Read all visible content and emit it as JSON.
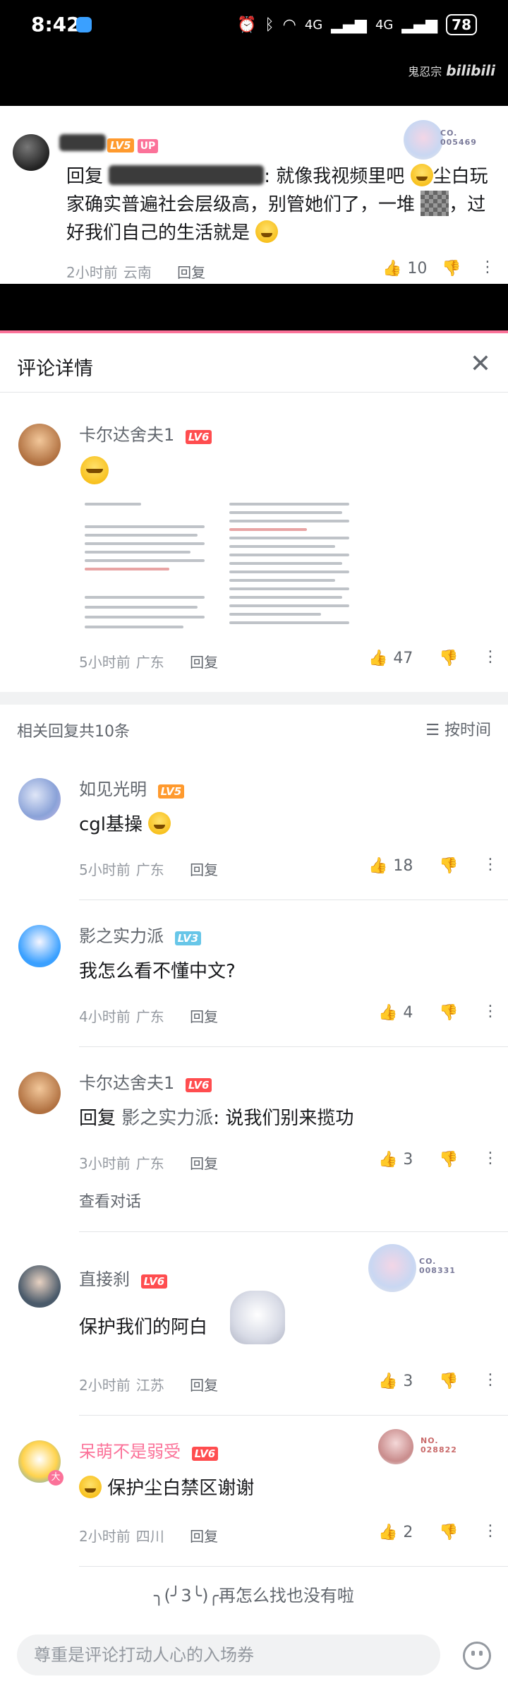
{
  "status_bar": {
    "time": "8:42",
    "battery": "78",
    "signal_a": "4G",
    "signal_b": "4G"
  },
  "video": {
    "watermark_name": "鬼忍宗",
    "watermark_brand": "bilibili"
  },
  "top_comment": {
    "level": "LV5",
    "up_tag": "UP",
    "text_prefix": "回复",
    "text_a": ": 就像我视频里吧",
    "text_b": "尘白玩家确实普遍社会层级高，别管她们了，一堆",
    "text_c": "，过好我们自己的生活就是",
    "time": "2小时前",
    "location": "云南",
    "reply": "回复",
    "likes": "10",
    "badge_no": "CO.\n005469"
  },
  "panel": {
    "title": "评论详情",
    "main": {
      "username": "卡尔达舍夫1",
      "level": "LV6",
      "time": "5小时前",
      "location": "广东",
      "reply": "回复",
      "likes": "47"
    },
    "replies_header": "相关回复共10条",
    "sort": "按时间",
    "replies": [
      {
        "username": "如见光明",
        "level": "LV5",
        "text": "cgl基操",
        "time": "5小时前",
        "location": "广东",
        "reply": "回复",
        "likes": "18"
      },
      {
        "username": "影之实力派",
        "level": "LV3",
        "text": "我怎么看不懂中文?",
        "time": "4小时前",
        "location": "广东",
        "reply": "回复",
        "likes": "4"
      },
      {
        "username": "卡尔达舍夫1",
        "level": "LV6",
        "text_prefix": "回复",
        "text_mention": "影之实力派",
        "text": ": 说我们别来揽功",
        "time": "3小时前",
        "location": "广东",
        "reply": "回复",
        "likes": "3",
        "view_conversation": "查看对话"
      },
      {
        "username": "直接刹",
        "level": "LV6",
        "text": "保护我们的阿白",
        "time": "2小时前",
        "location": "江苏",
        "reply": "回复",
        "likes": "3",
        "badge_no": "CO.\n008331"
      },
      {
        "username": "呆萌不是弱受",
        "level": "LV6",
        "text": "保护尘白禁区谢谢",
        "time": "2小时前",
        "location": "四川",
        "reply": "回复",
        "likes": "2",
        "badge_no": "NO.\n028822"
      }
    ],
    "end_text": "╮(╯3╰)╭再怎么找也没有啦",
    "input_placeholder": "尊重是评论打动人心的入场券"
  },
  "colors": {
    "pink": "#fb7299",
    "lv5": "#ff9a2e",
    "lv6": "#ff4d4f",
    "lv3": "#67c6e8",
    "gray_text": "#9499a0"
  }
}
